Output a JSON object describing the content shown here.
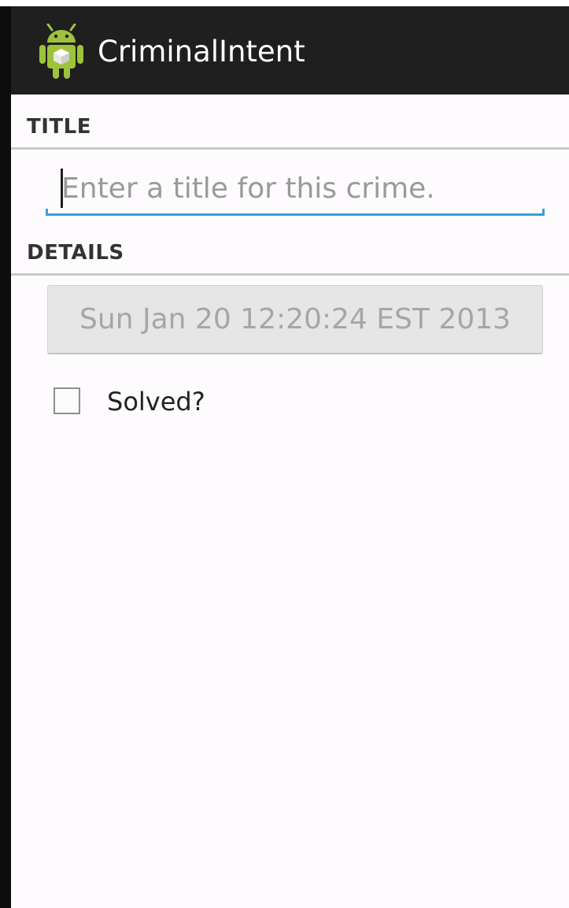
{
  "app": {
    "title": "CriminalIntent",
    "icon": "android-icon"
  },
  "title_section": {
    "header": "TITLE",
    "input_value": "",
    "input_placeholder": "Enter a title for this crime."
  },
  "details_section": {
    "header": "DETAILS",
    "date_button_label": "Sun Jan 20 12:20:24 EST 2013",
    "solved_label": "Solved?",
    "solved_checked": false
  },
  "colors": {
    "action_bar": "#1f1f1f",
    "accent": "#33a3cf",
    "android_green": "#9dc33b"
  }
}
